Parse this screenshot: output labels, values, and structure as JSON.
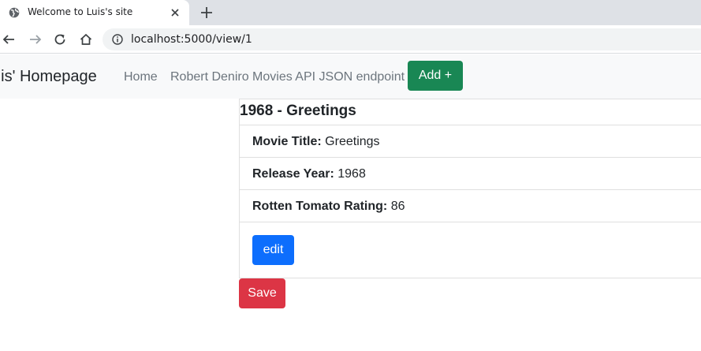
{
  "browser": {
    "tab_title": "Welcome to Luis's site",
    "url": "localhost:5000/view/1",
    "icons": [
      "globe-icon",
      "close-icon",
      "plus-icon",
      "back-icon",
      "forward-icon",
      "reload-icon",
      "home-icon",
      "info-icon"
    ]
  },
  "navbar": {
    "brand": "uis' Homepage",
    "links": [
      "Home",
      "Robert Deniro Movies API JSON endpoint"
    ],
    "add_button": "Add +"
  },
  "card": {
    "title": "1968 - Greetings",
    "fields": [
      {
        "label": "Movie Title:",
        "value": "Greetings"
      },
      {
        "label": "Release Year:",
        "value": "1968"
      },
      {
        "label": "Rotten Tomato Rating:",
        "value": "86"
      }
    ],
    "edit_button": "edit"
  },
  "save_button": "Save",
  "colors": {
    "success": "#198754",
    "primary": "#0d6efd",
    "danger": "#dc3545"
  }
}
